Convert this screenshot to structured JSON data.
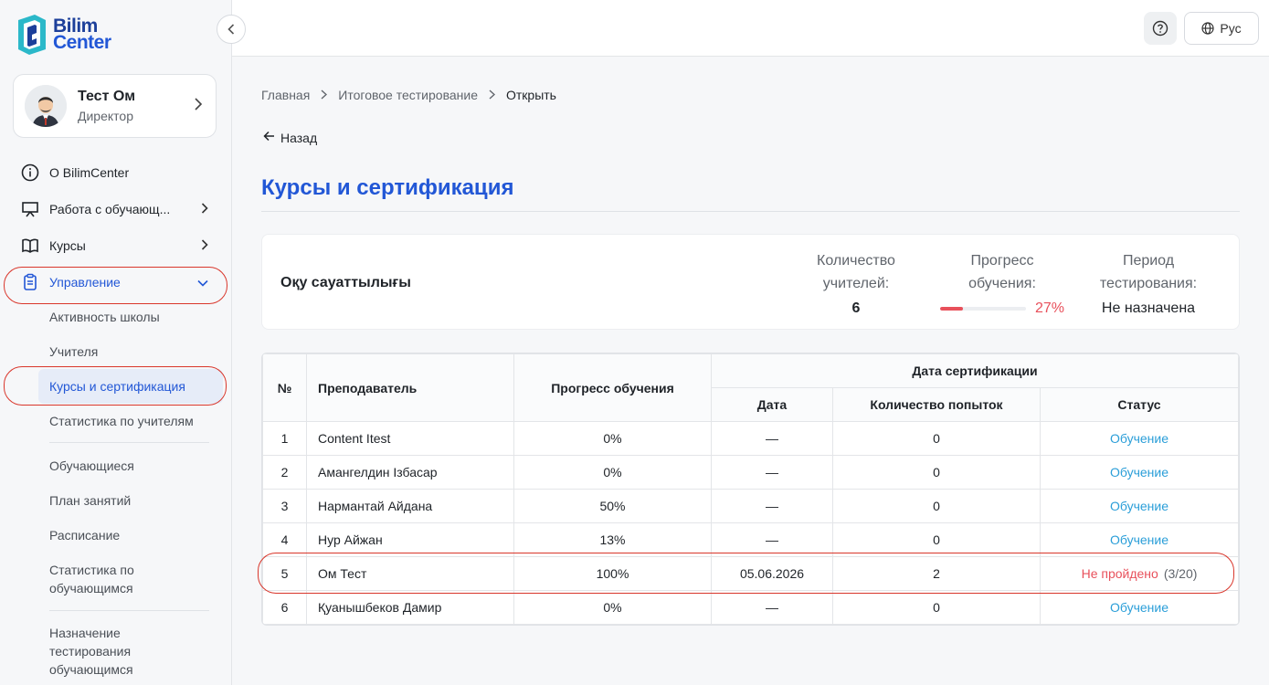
{
  "logo": {
    "line1": "Bilim",
    "line2": "Center"
  },
  "profile": {
    "name": "Тест Ом",
    "role": "Директор"
  },
  "nav": {
    "items": [
      {
        "label": "О BilimCenter",
        "icon": "info-icon"
      },
      {
        "label": "Работа с обучающ...",
        "icon": "presentation-icon"
      },
      {
        "label": "Курсы",
        "icon": "book-icon"
      },
      {
        "label": "Управление",
        "icon": "clipboard-icon"
      }
    ],
    "sub": {
      "activity": "Активность школы",
      "teachers": "Учителя",
      "courses": "Курсы и сертификация",
      "teacher_stats": "Статистика по учителям",
      "students": "Обучающиеся",
      "plan": "План занятий",
      "schedule": "Расписание",
      "student_stats": "Статистика по обучающимся",
      "assign_test": "Назначение тестирования обучающимся"
    }
  },
  "topbar": {
    "lang": "Рус"
  },
  "breadcrumb": {
    "home": "Главная",
    "section": "Итоговое тестирование",
    "current": "Открыть"
  },
  "back_label": "Назад",
  "page_title": "Курсы и сертификация",
  "course": {
    "name": "Оқу сауаттылығы",
    "teachers_label": "Количество учителей:",
    "teachers_value": "6",
    "progress_label": "Прогресс обучения:",
    "progress_value": "27%",
    "progress_fraction": 0.27,
    "period_label": "Период тестирования:",
    "period_value": "Не назначена"
  },
  "table": {
    "headers": {
      "num": "№",
      "teacher": "Преподаватель",
      "progress": "Прогресс обучения",
      "cert_group": "Дата сертификации",
      "date": "Дата",
      "attempts": "Количество попыток",
      "status": "Статус"
    },
    "rows": [
      {
        "num": "1",
        "teacher": "Content Itest",
        "progress": "0%",
        "date": "—",
        "attempts": "0",
        "status": "Обучение",
        "status_extra": ""
      },
      {
        "num": "2",
        "teacher": "Амангелдин Ізбасар",
        "progress": "0%",
        "date": "—",
        "attempts": "0",
        "status": "Обучение",
        "status_extra": ""
      },
      {
        "num": "3",
        "teacher": "Нармантай Айдана",
        "progress": "50%",
        "date": "—",
        "attempts": "0",
        "status": "Обучение",
        "status_extra": ""
      },
      {
        "num": "4",
        "teacher": "Нур Айжан",
        "progress": "13%",
        "date": "—",
        "attempts": "0",
        "status": "Обучение",
        "status_extra": ""
      },
      {
        "num": "5",
        "teacher": "Ом Тест",
        "progress": "100%",
        "date": "05.06.2026",
        "attempts": "2",
        "status": "Не пройдено",
        "status_extra": "(3/20)"
      },
      {
        "num": "6",
        "teacher": "Қуанышбеков Дамир",
        "progress": "0%",
        "date": "—",
        "attempts": "0",
        "status": "Обучение",
        "status_extra": ""
      }
    ]
  },
  "colors": {
    "accent": "#2257d6",
    "learning": "#2a9ed8",
    "failed": "#e8505b",
    "annotation": "#d9362b"
  }
}
